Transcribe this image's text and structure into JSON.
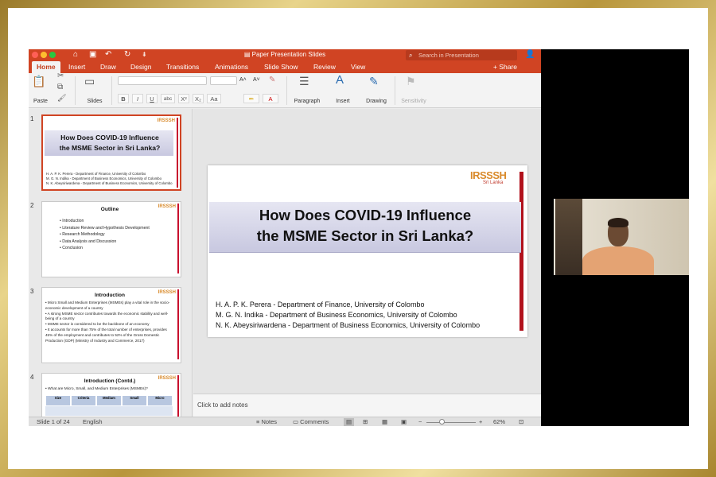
{
  "window": {
    "title": "Paper Presentation Slides",
    "search_placeholder": "Search in Presentation"
  },
  "tabs": [
    "Home",
    "Insert",
    "Draw",
    "Design",
    "Transitions",
    "Animations",
    "Slide Show",
    "Review",
    "View"
  ],
  "active_tab": "Home",
  "share_label": "Share",
  "ribbon": {
    "paste": "Paste",
    "slides": "Slides",
    "paragraph": "Paragraph",
    "insert": "Insert",
    "drawing": "Drawing",
    "sensitivity": "Sensitivity",
    "format_buttons": [
      "B",
      "I",
      "U",
      "abc",
      "X²",
      "X₂",
      "Aa"
    ]
  },
  "thumbnails": [
    {
      "num": "1",
      "title_lines": [
        "How Does COVID-19 Influence",
        "the MSME Sector in Sri Lanka?"
      ],
      "authors": [
        "H. A. P. K. Perera - Department of Finance, University of Colombo",
        "M. G. N. Indika - Department of Business Economics, University of Colombo",
        "N. K. Abeysiriwardena - Department of Business Economics, University of Colombo"
      ]
    },
    {
      "num": "2",
      "title": "Outline",
      "bullets": [
        "Introduction",
        "Literature Review and Hypothesis Development",
        "Research Methodology",
        "Data Analysis and Discussion",
        "Conclusion"
      ]
    },
    {
      "num": "3",
      "title": "Introduction",
      "bullets": [
        "Micro Small and Medium Enterprises (MSMEs) play a vital role in the socio-economic development of a country",
        "A strong MSME sector contributes towards the economic stability and well-being of a country",
        "MSME sector is considered to be the backbone of an economy",
        "It accounts for more than 75% of the total number of enterprises, provides 45% of the employment and contributes to 52% of the Gross Domestic Production (GDP) (Ministry of Industry and Commerce, 2017)"
      ]
    },
    {
      "num": "4",
      "title": "Introduction (Contd.)",
      "bullets": [
        "What are Micro, Small, and Medium Enterprises (MSMEs)?"
      ],
      "table_header": [
        "Size",
        "Criteria",
        "Medium",
        "Small",
        "Micro"
      ]
    }
  ],
  "logo": {
    "name": "IRSSSH",
    "sub": "Sri Lanka"
  },
  "slide": {
    "title_lines": [
      "How Does COVID-19 Influence",
      "the MSME Sector in Sri Lanka?"
    ],
    "authors": [
      "H. A. P. K. Perera - Department of Finance, University of Colombo",
      "M. G. N. Indika - Department of Business Economics, University of Colombo",
      "N. K. Abeysiriwardena - Department of Business Economics, University of Colombo"
    ]
  },
  "notes_placeholder": "Click to add notes",
  "status": {
    "slide_info": "Slide 1 of 24",
    "language": "English",
    "notes": "Notes",
    "comments": "Comments",
    "zoom": "62%"
  },
  "colors": {
    "accent": "#d04423",
    "slide_red": "#b1111c",
    "logo_orange": "#d98a2b"
  }
}
